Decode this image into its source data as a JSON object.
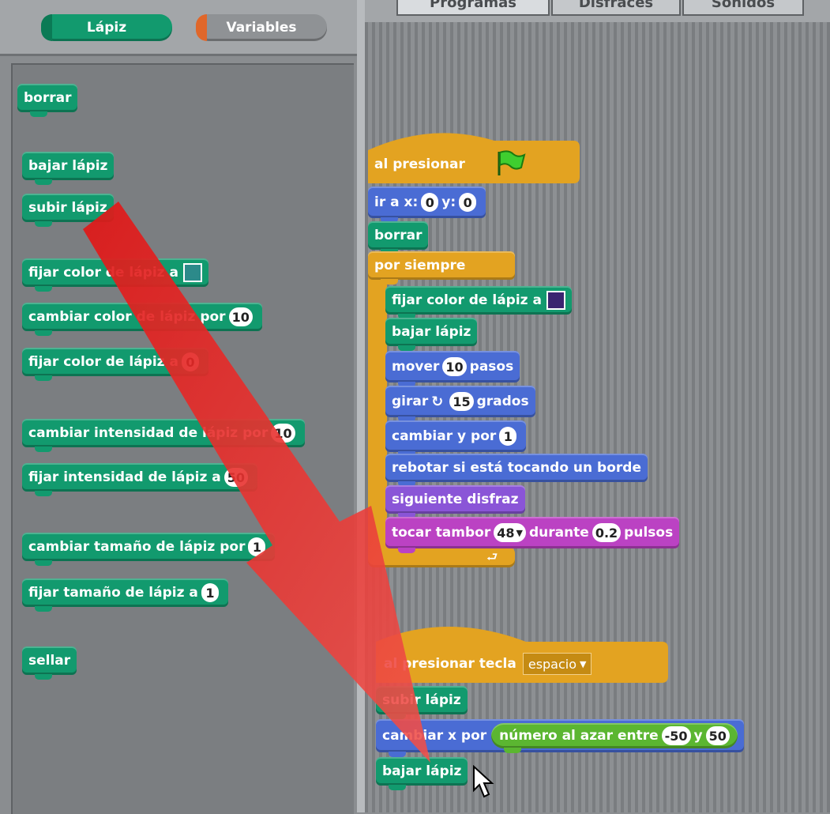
{
  "categories": [
    {
      "label": "Lápiz",
      "color": "#129a6e"
    },
    {
      "label": "Variables",
      "color": "#e0672a"
    }
  ],
  "tabs": [
    {
      "label": "Programas"
    },
    {
      "label": "Disfraces"
    },
    {
      "label": "Sonidos"
    }
  ],
  "palette": {
    "borrar": "borrar",
    "bajar_lapiz": "bajar lápiz",
    "subir_lapiz": "subir lápiz",
    "fijar_color_a": "fijar color de lápiz a",
    "cambiar_color_por": "cambiar color de lápiz por",
    "cambiar_color_por_val": "10",
    "fijar_color_de_lapiz": "fijar color de lápiz a",
    "fijar_color_de_lapiz_val": "0",
    "cambiar_intensidad": "cambiar intensidad de lápiz por",
    "cambiar_intensidad_val": "10",
    "fijar_intensidad": "fijar intensidad de lápiz a",
    "fijar_intensidad_val": "50",
    "cambiar_tamano": "cambiar tamaño de lápiz por",
    "cambiar_tamano_val": "1",
    "fijar_tamano": "fijar tamaño de lápiz a",
    "fijar_tamano_val": "1",
    "sellar": "sellar"
  },
  "script1": {
    "hat": "al presionar",
    "goto_label": "ir a x:",
    "goto_x": "0",
    "goto_y_label": "y:",
    "goto_y": "0",
    "borrar": "borrar",
    "forever": "por siempre",
    "set_color": "fijar color de lápiz a",
    "pen_down": "bajar lápiz",
    "move": "mover",
    "move_val": "10",
    "move_unit": "pasos",
    "turn": "girar",
    "turn_val": "15",
    "turn_unit": "grados",
    "change_y": "cambiar y por",
    "change_y_val": "1",
    "bounce": "rebotar si está tocando un borde",
    "next_costume": "siguiente disfraz",
    "drum": "tocar tambor",
    "drum_val": "48",
    "drum_mid": "durante",
    "drum_beats": "0.2",
    "drum_unit": "pulsos"
  },
  "script2": {
    "hat": "al presionar tecla",
    "key": "espacio",
    "pen_up": "subir lápiz",
    "change_x": "cambiar x por",
    "random": "número al azar entre",
    "random_min": "-50",
    "random_and": "y",
    "random_max": "50",
    "pen_down": "bajar lápiz"
  },
  "colors": {
    "pen": "#129a6e",
    "motion": "#4a6cd4",
    "control": "#e3a321",
    "looks": "#8a55d7",
    "sound": "#bb42c3",
    "operators": "#5bb631",
    "arrow": "#e8312f",
    "swatch_palette": "#2c8a8a",
    "swatch_script": "#3a2470"
  },
  "icons": {
    "flag": "green-flag-icon",
    "turn": "rotate-right-icon",
    "arrow": "red-arrow-overlay",
    "cursor": "mouse-pointer-icon"
  }
}
